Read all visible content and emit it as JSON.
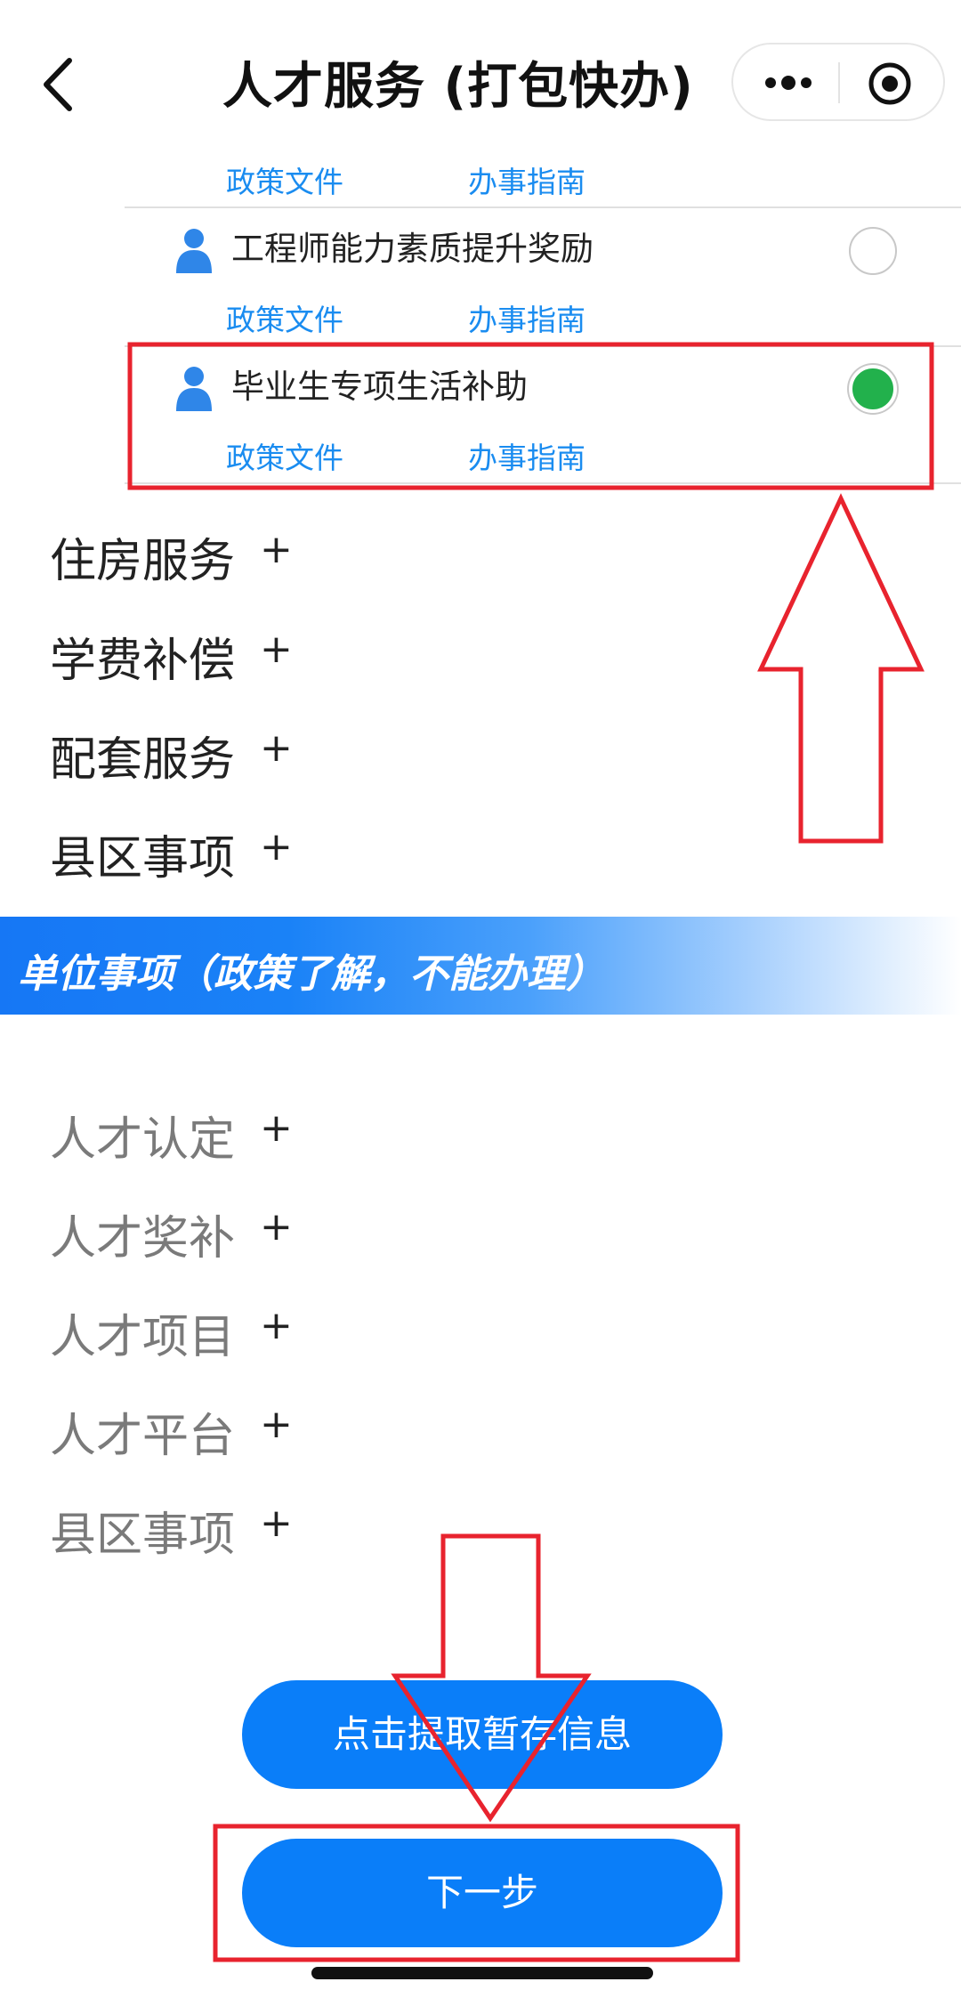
{
  "header": {
    "title": "人才服务 (打包快办)",
    "back_icon": "chevron-left-icon",
    "more_icon": "more-dots-icon",
    "close_icon": "target-icon"
  },
  "top_links": {
    "policy": "政策文件",
    "guide": "办事指南"
  },
  "items": [
    {
      "label": "工程师能力素质提升奖励",
      "selected": false,
      "policy": "政策文件",
      "guide": "办事指南",
      "icon": "person-icon"
    },
    {
      "label": "毕业生专项生活补助",
      "selected": true,
      "policy": "政策文件",
      "guide": "办事指南",
      "icon": "person-icon"
    }
  ],
  "personal_categories": [
    {
      "label": "住房服务",
      "toggle": "+"
    },
    {
      "label": "学费补偿",
      "toggle": "+"
    },
    {
      "label": "配套服务",
      "toggle": "+"
    },
    {
      "label": "县区事项",
      "toggle": "+"
    }
  ],
  "banner": {
    "text": "单位事项（政策了解，不能办理）"
  },
  "unit_categories": [
    {
      "label": "人才认定",
      "toggle": "+"
    },
    {
      "label": "人才奖补",
      "toggle": "+"
    },
    {
      "label": "人才项目",
      "toggle": "+"
    },
    {
      "label": "人才平台",
      "toggle": "+"
    },
    {
      "label": "县区事项",
      "toggle": "+"
    }
  ],
  "buttons": {
    "fetch_draft": "点击提取暂存信息",
    "next": "下一步"
  },
  "colors": {
    "accent": "#0a7ef9",
    "link": "#1a8cf0",
    "selected": "#22b14c",
    "annotation": "#e8232e"
  }
}
